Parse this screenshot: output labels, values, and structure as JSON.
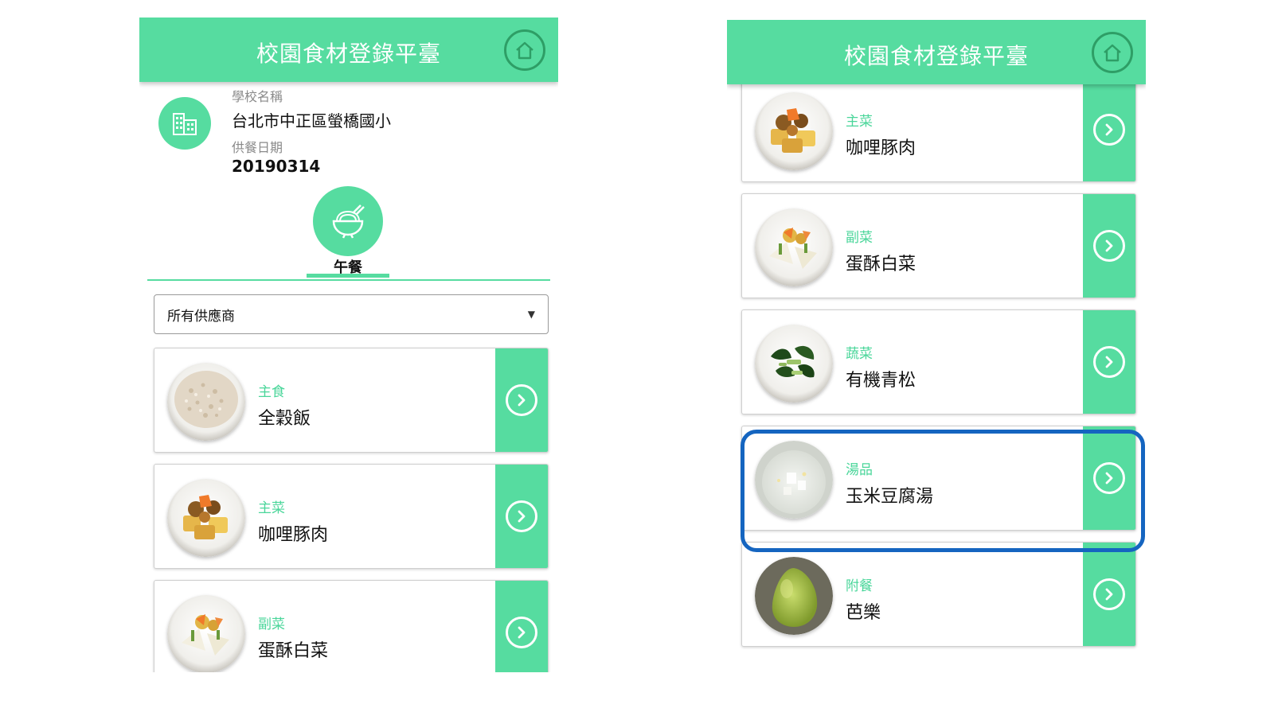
{
  "app": {
    "title": "校園食材登錄平臺",
    "home_icon": "home-icon"
  },
  "colors": {
    "accent": "#56dca0",
    "accent_dark": "#2e9e66",
    "category_text": "#4ad69a",
    "highlight": "#1565c0"
  },
  "left_screen": {
    "school_name_label": "學校名稱",
    "school_name": "台北市中正區螢橋國小",
    "date_label": "供餐日期",
    "date": "20190314",
    "meal_tab_label": "午餐",
    "supplier_select": {
      "value": "所有供應商"
    },
    "dishes": [
      {
        "category": "主食",
        "name": "全穀飯",
        "image": "rice-photo"
      },
      {
        "category": "主菜",
        "name": "咖哩豚肉",
        "image": "curry-pork-photo"
      },
      {
        "category": "副菜",
        "name": "蛋酥白菜",
        "image": "cabbage-photo"
      }
    ]
  },
  "right_screen": {
    "dishes": [
      {
        "category": "主菜",
        "name": "咖哩豚肉",
        "image": "curry-pork-photo"
      },
      {
        "category": "副菜",
        "name": "蛋酥白菜",
        "image": "cabbage-photo"
      },
      {
        "category": "蔬菜",
        "name": "有機青松",
        "image": "greens-photo"
      },
      {
        "category": "湯品",
        "name": "玉米豆腐湯",
        "image": "tofu-soup-photo",
        "highlighted": true
      },
      {
        "category": "附餐",
        "name": "芭樂",
        "image": "guava-photo"
      }
    ]
  }
}
